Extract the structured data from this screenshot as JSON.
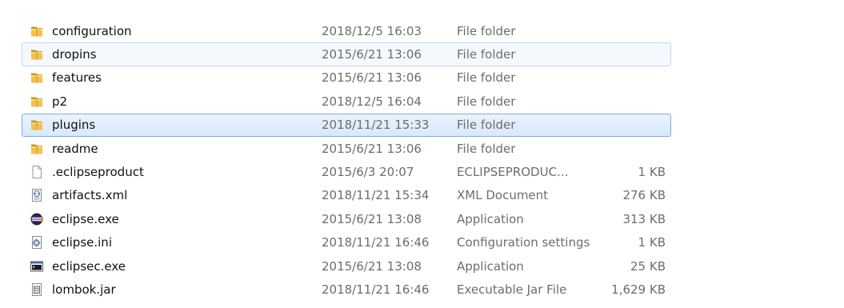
{
  "file_list": {
    "rows": [
      {
        "name": "configuration",
        "date": "2018/12/5 16:03",
        "type": "File folder",
        "size": "",
        "icon": "folder-icon",
        "state": "normal"
      },
      {
        "name": "dropins",
        "date": "2015/6/21 13:06",
        "type": "File folder",
        "size": "",
        "icon": "folder-icon",
        "state": "hover"
      },
      {
        "name": "features",
        "date": "2015/6/21 13:06",
        "type": "File folder",
        "size": "",
        "icon": "folder-icon",
        "state": "normal"
      },
      {
        "name": "p2",
        "date": "2018/12/5 16:04",
        "type": "File folder",
        "size": "",
        "icon": "folder-icon",
        "state": "normal"
      },
      {
        "name": "plugins",
        "date": "2018/11/21 15:33",
        "type": "File folder",
        "size": "",
        "icon": "folder-icon",
        "state": "selected"
      },
      {
        "name": "readme",
        "date": "2015/6/21 13:06",
        "type": "File folder",
        "size": "",
        "icon": "folder-icon",
        "state": "normal"
      },
      {
        "name": ".eclipseproduct",
        "date": "2015/6/3 20:07",
        "type": "ECLIPSEPRODUC...",
        "size": "1 KB",
        "icon": "blank-file-icon",
        "state": "normal"
      },
      {
        "name": "artifacts.xml",
        "date": "2018/11/21 15:34",
        "type": "XML Document",
        "size": "276 KB",
        "icon": "xml-file-icon",
        "state": "normal"
      },
      {
        "name": "eclipse.exe",
        "date": "2015/6/21 13:08",
        "type": "Application",
        "size": "313 KB",
        "icon": "eclipse-app-icon",
        "state": "normal"
      },
      {
        "name": "eclipse.ini",
        "date": "2018/11/21 16:46",
        "type": "Configuration settings",
        "size": "1 KB",
        "icon": "settings-file-icon",
        "state": "normal"
      },
      {
        "name": "eclipsec.exe",
        "date": "2015/6/21 13:08",
        "type": "Application",
        "size": "25 KB",
        "icon": "console-app-icon",
        "state": "normal"
      },
      {
        "name": "lombok.jar",
        "date": "2018/11/21 16:46",
        "type": "Executable Jar File",
        "size": "1,629 KB",
        "icon": "jar-file-icon",
        "state": "normal"
      }
    ]
  }
}
